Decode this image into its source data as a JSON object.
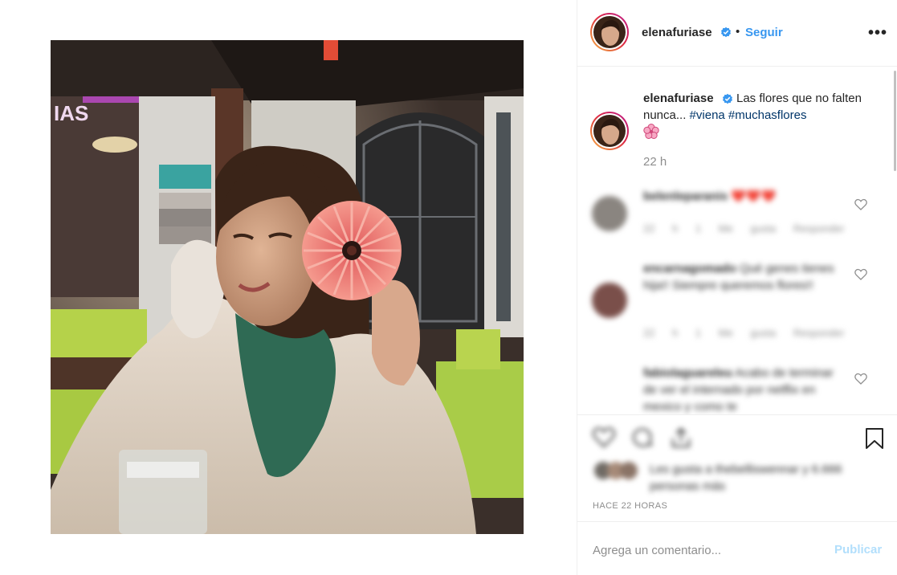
{
  "post": {
    "username": "elenafuriase",
    "follow_label": "Seguir",
    "separator": "•",
    "more_label": "•••",
    "caption_text": "Las flores que no falten nunca...",
    "hashtags": [
      "#viena",
      "#muchasflores"
    ],
    "caption_time": "22 h"
  },
  "comments": [
    {
      "username": "belenleparanis",
      "text": "❤️❤️❤️",
      "meta": "22 h   1 Me gusta   Responder"
    },
    {
      "username": "encarnagomado",
      "text": "Qué genes tienes hija!! Siempre queremos flores!!",
      "meta": "22 h   1 Me gusta   Responder"
    },
    {
      "username": "fabiolaguareleu",
      "text": "Acabo de terminar de ver el internado por netflix en mexico y como te"
    }
  ],
  "likes": {
    "text": "Les gusta a thebelliswennar y 6.666 personas más"
  },
  "timeago": "HACE 22 HORAS",
  "add_comment": {
    "placeholder": "Agrega un comentario...",
    "publish_label": "Publicar"
  },
  "colors": {
    "link_blue": "#3897f0",
    "hashtag": "#003569",
    "muted": "#8e8e8e",
    "publish_disabled": "#b2dffc",
    "verified_badge": "#3897f0"
  },
  "icons": [
    "verified-badge-icon",
    "more-options-icon",
    "heart-icon",
    "comment-icon",
    "share-icon",
    "bookmark-icon",
    "cherry-blossom-emoji"
  ]
}
